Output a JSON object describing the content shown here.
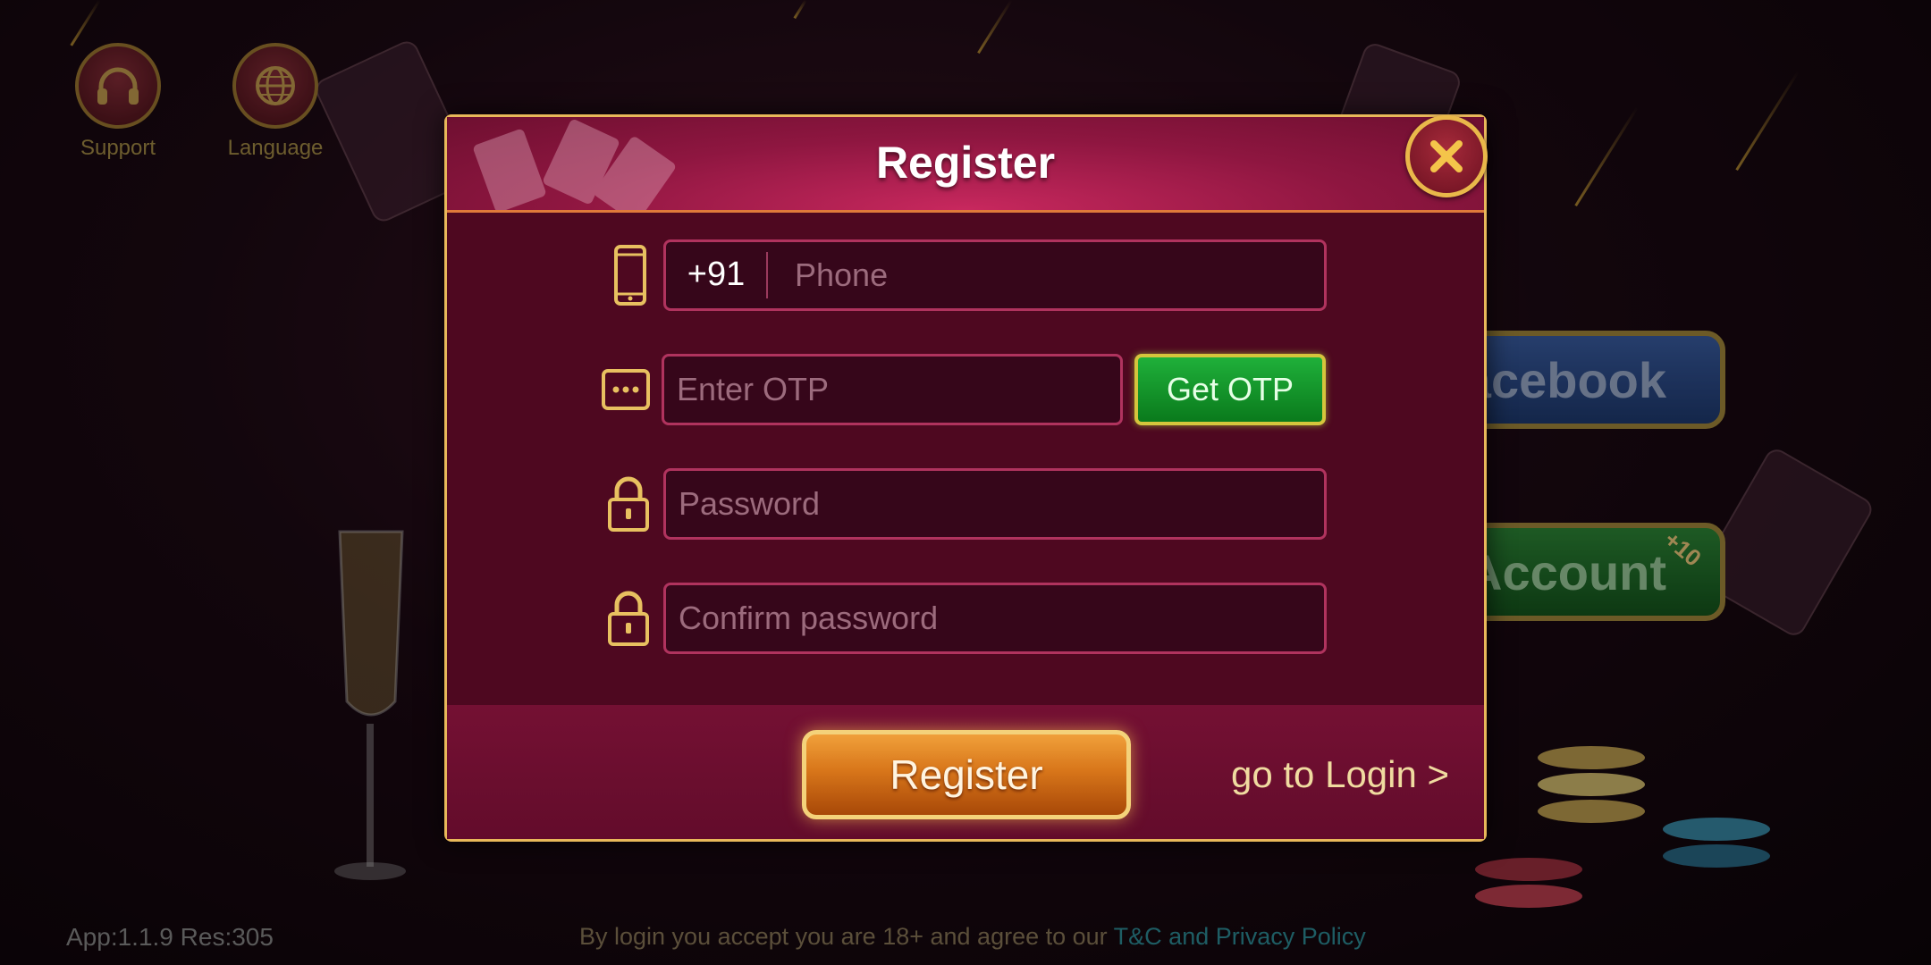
{
  "top_buttons": [
    {
      "label": "Support",
      "icon": "headphones-icon"
    },
    {
      "label": "Language",
      "icon": "globe-icon"
    }
  ],
  "side_buttons": {
    "facebook": "Facebook",
    "account": "Account",
    "account_badge": "+10"
  },
  "modal": {
    "title": "Register",
    "phone": {
      "prefix": "+91",
      "placeholder": "Phone"
    },
    "otp": {
      "placeholder": "Enter OTP",
      "button": "Get OTP"
    },
    "password": {
      "placeholder": "Password"
    },
    "confirm": {
      "placeholder": "Confirm password"
    },
    "register_button": "Register",
    "login_link": "go to Login >"
  },
  "footer": {
    "app_info": "App:1.1.9 Res:305",
    "terms_text": "By login you accept you are 18+ and agree to our ",
    "terms_link": "T&C and ",
    "privacy_link": "Privacy Policy"
  },
  "colors": {
    "accent_gold": "#e8b85a",
    "modal_bg": "#5e0b26",
    "otp_green": "#1fb03a",
    "register_orange": "#d8761a"
  }
}
